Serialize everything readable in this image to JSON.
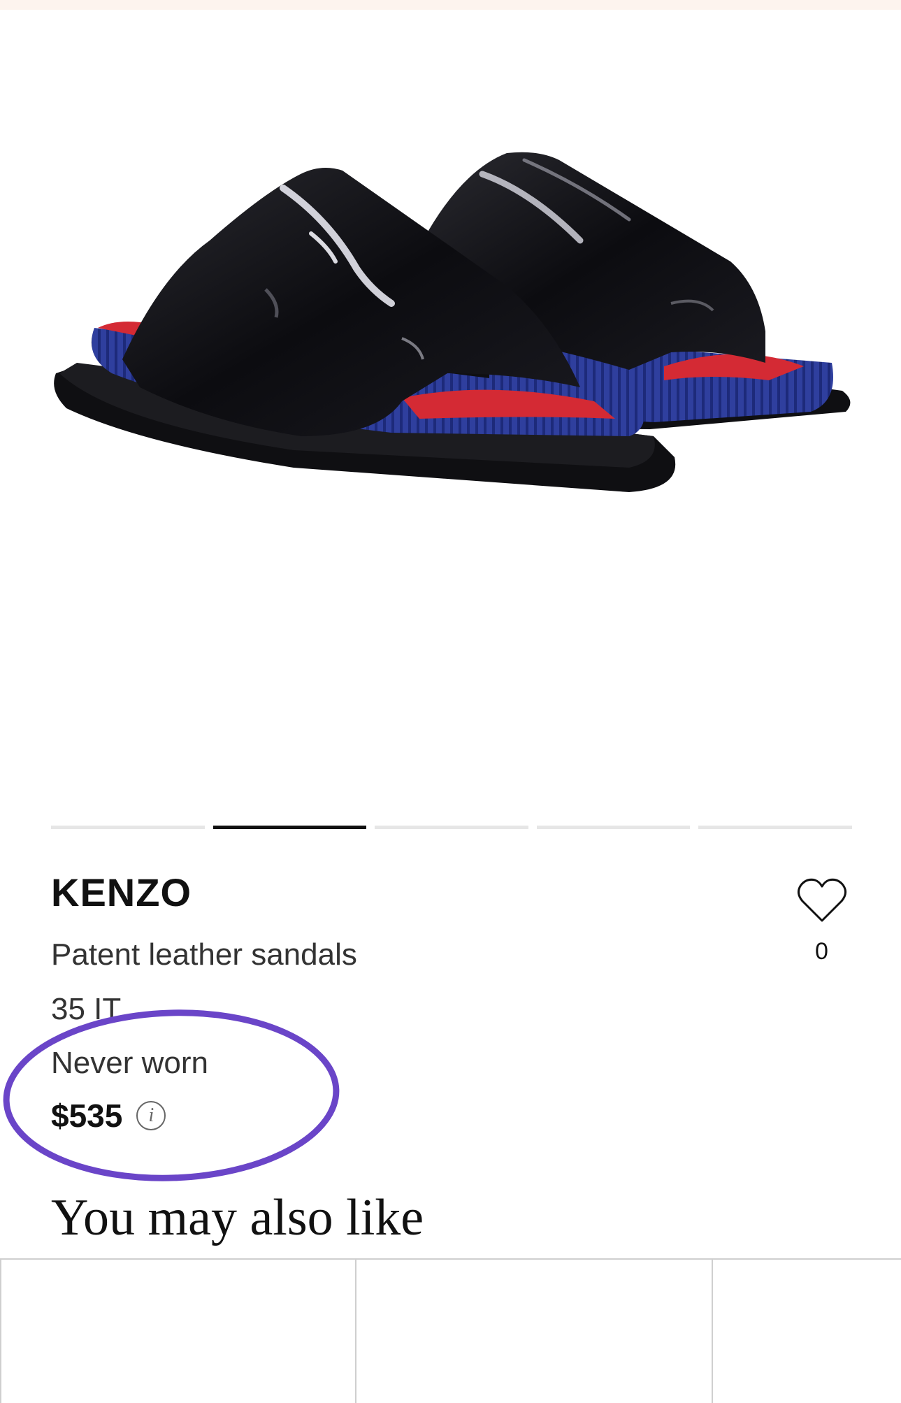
{
  "product": {
    "brand": "KENZO",
    "name": "Patent leather sandals",
    "size": "35 IT",
    "condition": "Never worn",
    "price": "$535",
    "info_icon": "i"
  },
  "gallery": {
    "image_alt": "Kenzo black patent leather slide sandals with blue and red soles",
    "slide_count": 5,
    "active_slide": 2
  },
  "favorites": {
    "icon": "heart-outline-icon",
    "count": "0"
  },
  "recommendations": {
    "title": "You may also like",
    "visible_cards": 3
  },
  "annotation": {
    "color": "#6a45c8"
  },
  "colors": {
    "text": "#111111",
    "secondary_text": "#333333",
    "pager_inactive": "#e6e6e6",
    "pager_active": "#111111",
    "top_strip": "#fdf4ee",
    "sole_blue": "#2f3f9e",
    "insole_red": "#d42a34"
  }
}
